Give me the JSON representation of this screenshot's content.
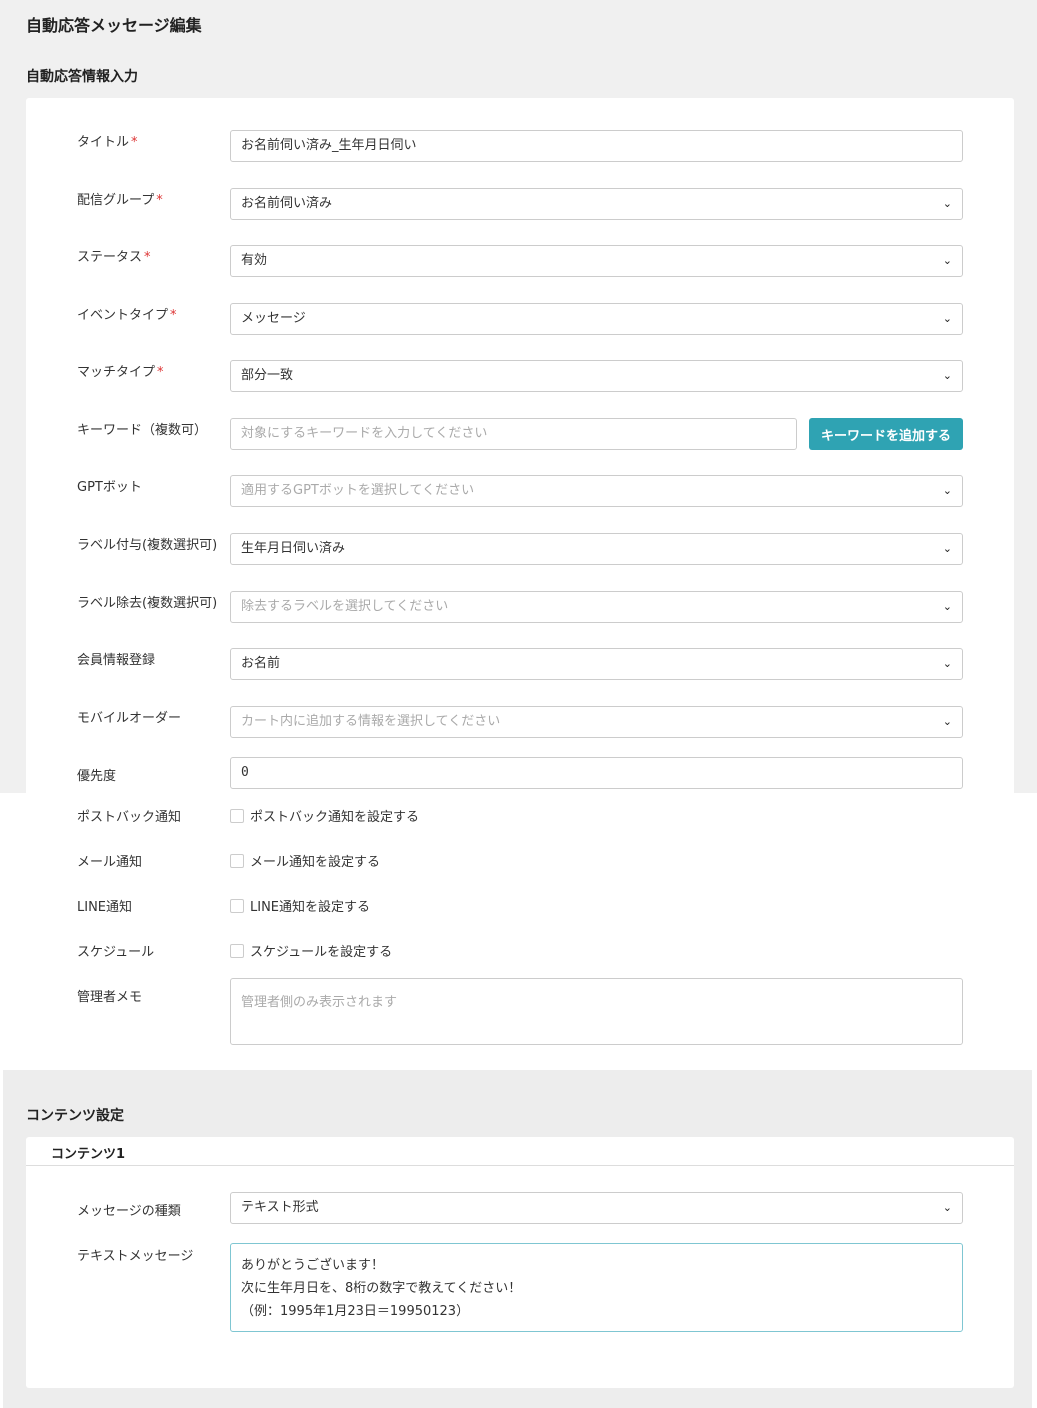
{
  "page": {
    "title": "自動応答メッセージ編集"
  },
  "info_section": {
    "title": "自動応答情報入力",
    "required_mark": "*",
    "title_field": {
      "label": "タイトル",
      "value": "お名前伺い済み_生年月日伺い"
    },
    "group_field": {
      "label": "配信グループ",
      "value": "お名前伺い済み"
    },
    "status_field": {
      "label": "ステータス",
      "value": "有効"
    },
    "event_field": {
      "label": "イベントタイプ",
      "value": "メッセージ"
    },
    "match_field": {
      "label": "マッチタイプ",
      "value": "部分一致"
    },
    "keyword_field": {
      "label": "キーワード（複数可）",
      "placeholder": "対象にするキーワードを入力してください",
      "button_label": "キーワードを追加する"
    },
    "gpt_field": {
      "label": "GPTボット",
      "placeholder": "適用するGPTボットを選択してください"
    },
    "label_add_field": {
      "label": "ラベル付与(複数選択可)",
      "value": "生年月日伺い済み"
    },
    "label_remove_field": {
      "label": "ラベル除去(複数選択可)",
      "placeholder": "除去するラベルを選択してください"
    },
    "member_field": {
      "label": "会員情報登録",
      "value": "お名前"
    },
    "mobile_order_field": {
      "label": "モバイルオーダー",
      "placeholder": "カート内に追加する情報を選択してください"
    },
    "priority_field": {
      "label": "優先度",
      "value": "0"
    },
    "postback_field": {
      "label": "ポストバック通知",
      "checkbox_label": "ポストバック通知を設定する"
    },
    "mail_field": {
      "label": "メール通知",
      "checkbox_label": "メール通知を設定する"
    },
    "line_field": {
      "label": "LINE通知",
      "checkbox_label": "LINE通知を設定する"
    },
    "schedule_field": {
      "label": "スケジュール",
      "checkbox_label": "スケジュールを設定する"
    },
    "memo_field": {
      "label": "管理者メモ",
      "placeholder": "管理者側のみ表示されます"
    }
  },
  "content_section": {
    "title": "コンテンツ設定",
    "content1": {
      "header": "コンテンツ1",
      "type_field": {
        "label": "メッセージの種類",
        "value": "テキスト形式"
      },
      "text_field": {
        "label": "テキストメッセージ",
        "lines": [
          "ありがとうございます！",
          "次に生年月日を、8桁の数字で教えてください！",
          "（例：1995年1月23日＝19950123）"
        ]
      }
    }
  },
  "icons": {
    "dropdown": "chevron-down-icon",
    "chevron_glyph": "⌄"
  },
  "colors": {
    "accent": "#2fa3b3",
    "required": "#d33333",
    "background": "#f0f0f0"
  }
}
